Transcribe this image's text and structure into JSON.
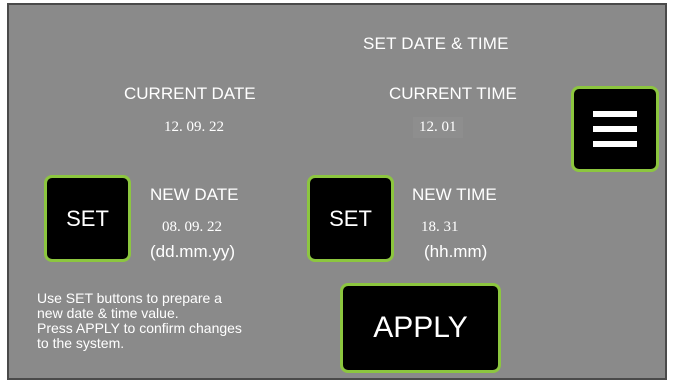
{
  "screen": {
    "title": "SET DATE & TIME"
  },
  "current_date": {
    "label": "CURRENT DATE",
    "value": "12. 09. 22"
  },
  "current_time": {
    "label": "CURRENT TIME",
    "value": "12. 01"
  },
  "menu_button": {
    "icon": "menu-icon"
  },
  "new_date": {
    "set_label": "SET",
    "label": "NEW DATE",
    "value": "08. 09. 22",
    "format": "(dd.mm.yy)"
  },
  "new_time": {
    "set_label": "SET",
    "label": "NEW TIME",
    "value": "18. 31",
    "format": "(hh.mm)"
  },
  "help_text": "Use SET buttons to prepare a\nnew date & time value.\nPress APPLY to confirm changes\nto the system.",
  "apply_button": {
    "label": "APPLY"
  },
  "colors": {
    "background": "#8a8a8a",
    "button": "#000000",
    "accent": "#8cc63f",
    "text": "#ffffff"
  }
}
